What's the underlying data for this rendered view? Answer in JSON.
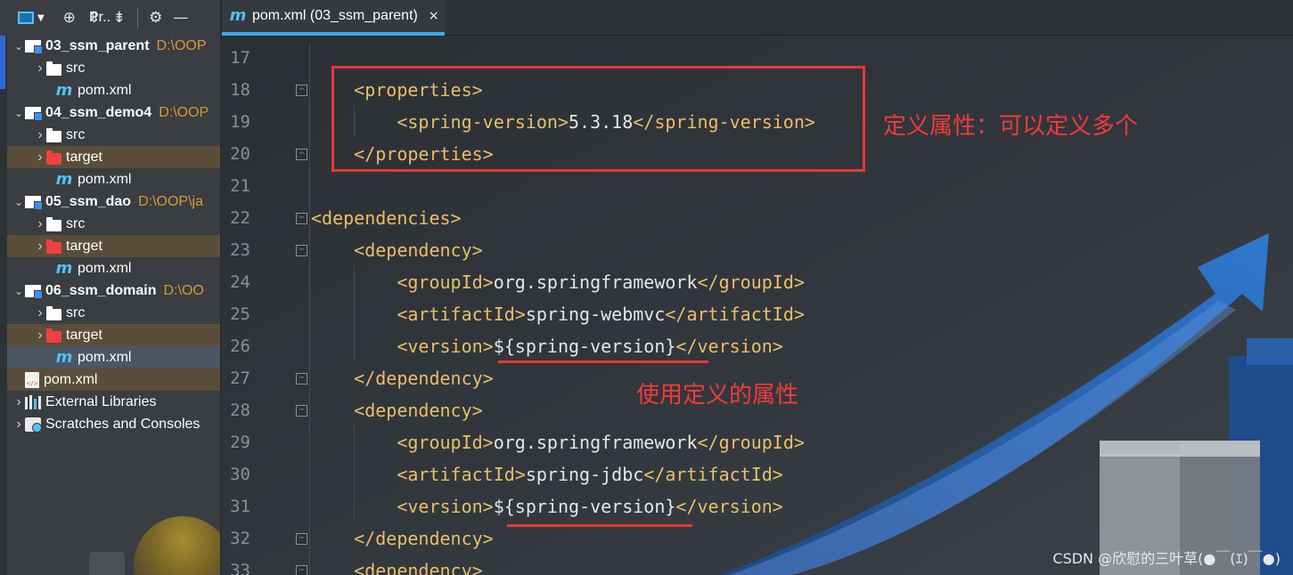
{
  "project_panel": {
    "title": "Pr..",
    "toolbar_icons": [
      "crosshair-icon",
      "expand-all-icon",
      "collapse-all-icon",
      "gear-icon",
      "minimize-icon"
    ],
    "tree": [
      {
        "label": "03_ssm_parent",
        "path": "D:\\OOP",
        "type": "module",
        "expanded": true,
        "bold": true
      },
      {
        "label": "src",
        "type": "folder",
        "expanded": false
      },
      {
        "label": "pom.xml",
        "type": "maven"
      },
      {
        "label": "04_ssm_demo4",
        "path": "D:\\OOP",
        "type": "module",
        "expanded": true,
        "bold": true
      },
      {
        "label": "src",
        "type": "folder",
        "expanded": false
      },
      {
        "label": "target",
        "type": "excluded-folder",
        "expanded": false
      },
      {
        "label": "pom.xml",
        "type": "maven"
      },
      {
        "label": "05_ssm_dao",
        "path": "D:\\OOP\\ja",
        "type": "module",
        "expanded": true,
        "bold": true
      },
      {
        "label": "src",
        "type": "folder",
        "expanded": false
      },
      {
        "label": "target",
        "type": "excluded-folder",
        "expanded": false
      },
      {
        "label": "pom.xml",
        "type": "maven"
      },
      {
        "label": "06_ssm_domain",
        "path": "D:\\OO",
        "type": "module",
        "expanded": true,
        "bold": true
      },
      {
        "label": "src",
        "type": "folder",
        "expanded": false
      },
      {
        "label": "target",
        "type": "excluded-folder",
        "expanded": false
      },
      {
        "label": "pom.xml",
        "type": "maven",
        "selected": true
      },
      {
        "label": "pom.xml",
        "type": "xml"
      },
      {
        "label": "External Libraries",
        "type": "libraries",
        "expanded": false
      },
      {
        "label": "Scratches and Consoles",
        "type": "scratches",
        "expanded": false
      }
    ]
  },
  "editor": {
    "tab": {
      "label": "pom.xml (03_ssm_parent)",
      "close": "×"
    },
    "lines": [
      {
        "n": "17",
        "tokens": []
      },
      {
        "n": "18",
        "fold": true,
        "tokens": [
          {
            "t": "    "
          },
          {
            "t": "<properties>",
            "c": "tag"
          }
        ]
      },
      {
        "n": "19",
        "tokens": [
          {
            "t": "        "
          },
          {
            "t": "<spring-version>",
            "c": "tag"
          },
          {
            "t": "5.3.18",
            "c": "val"
          },
          {
            "t": "</spring-version>",
            "c": "tag"
          }
        ]
      },
      {
        "n": "20",
        "fold": true,
        "tokens": [
          {
            "t": "    "
          },
          {
            "t": "</properties>",
            "c": "tag"
          }
        ]
      },
      {
        "n": "21",
        "tokens": []
      },
      {
        "n": "22",
        "fold": true,
        "tokens": [
          {
            "t": "<dependencies>",
            "c": "tag"
          }
        ]
      },
      {
        "n": "23",
        "fold": true,
        "tokens": [
          {
            "t": "    "
          },
          {
            "t": "<dependency>",
            "c": "tag"
          }
        ]
      },
      {
        "n": "24",
        "tokens": [
          {
            "t": "        "
          },
          {
            "t": "<groupId>",
            "c": "tag"
          },
          {
            "t": "org.springframework",
            "c": "val"
          },
          {
            "t": "</groupId>",
            "c": "tag"
          }
        ]
      },
      {
        "n": "25",
        "tokens": [
          {
            "t": "        "
          },
          {
            "t": "<artifactId>",
            "c": "tag"
          },
          {
            "t": "spring-webmvc",
            "c": "val"
          },
          {
            "t": "</artifactId>",
            "c": "tag"
          }
        ]
      },
      {
        "n": "26",
        "tokens": [
          {
            "t": "        "
          },
          {
            "t": "<version>",
            "c": "tag"
          },
          {
            "t": "${spring-version}",
            "c": "val"
          },
          {
            "t": "</version>",
            "c": "tag"
          }
        ]
      },
      {
        "n": "27",
        "fold": true,
        "tokens": [
          {
            "t": "    "
          },
          {
            "t": "</dependency>",
            "c": "tag"
          }
        ]
      },
      {
        "n": "28",
        "fold": true,
        "tokens": [
          {
            "t": "    "
          },
          {
            "t": "<dependency>",
            "c": "tag"
          }
        ]
      },
      {
        "n": "29",
        "tokens": [
          {
            "t": "        "
          },
          {
            "t": "<groupId>",
            "c": "tag"
          },
          {
            "t": "org.springframework",
            "c": "val"
          },
          {
            "t": "</groupId>",
            "c": "tag"
          }
        ]
      },
      {
        "n": "30",
        "tokens": [
          {
            "t": "        "
          },
          {
            "t": "<artifactId>",
            "c": "tag"
          },
          {
            "t": "spring-jdbc",
            "c": "val"
          },
          {
            "t": "</artifactId>",
            "c": "tag"
          }
        ]
      },
      {
        "n": "31",
        "tokens": [
          {
            "t": "        "
          },
          {
            "t": "<version>",
            "c": "tag"
          },
          {
            "t": "${spring-version}",
            "c": "val"
          },
          {
            "t": "</version>",
            "c": "tag"
          }
        ]
      },
      {
        "n": "32",
        "fold": true,
        "tokens": [
          {
            "t": "    "
          },
          {
            "t": "</dependency>",
            "c": "tag"
          }
        ]
      },
      {
        "n": "33",
        "fold": true,
        "tokens": [
          {
            "t": "    "
          },
          {
            "t": "<dependency>",
            "c": "tag"
          }
        ]
      }
    ]
  },
  "annotations": {
    "define_note": "定义属性：可以定义多个",
    "use_note": "使用定义的属性"
  },
  "watermark": "CSDN @欣慰的三叶草(●￣(ｴ)￣●)",
  "colors": {
    "tag": "#e8bf6a",
    "value": "#e6e6e6",
    "annotation_red": "#e53935",
    "tab_accent": "#3fa8e8",
    "path_orange": "#d79a3c"
  }
}
